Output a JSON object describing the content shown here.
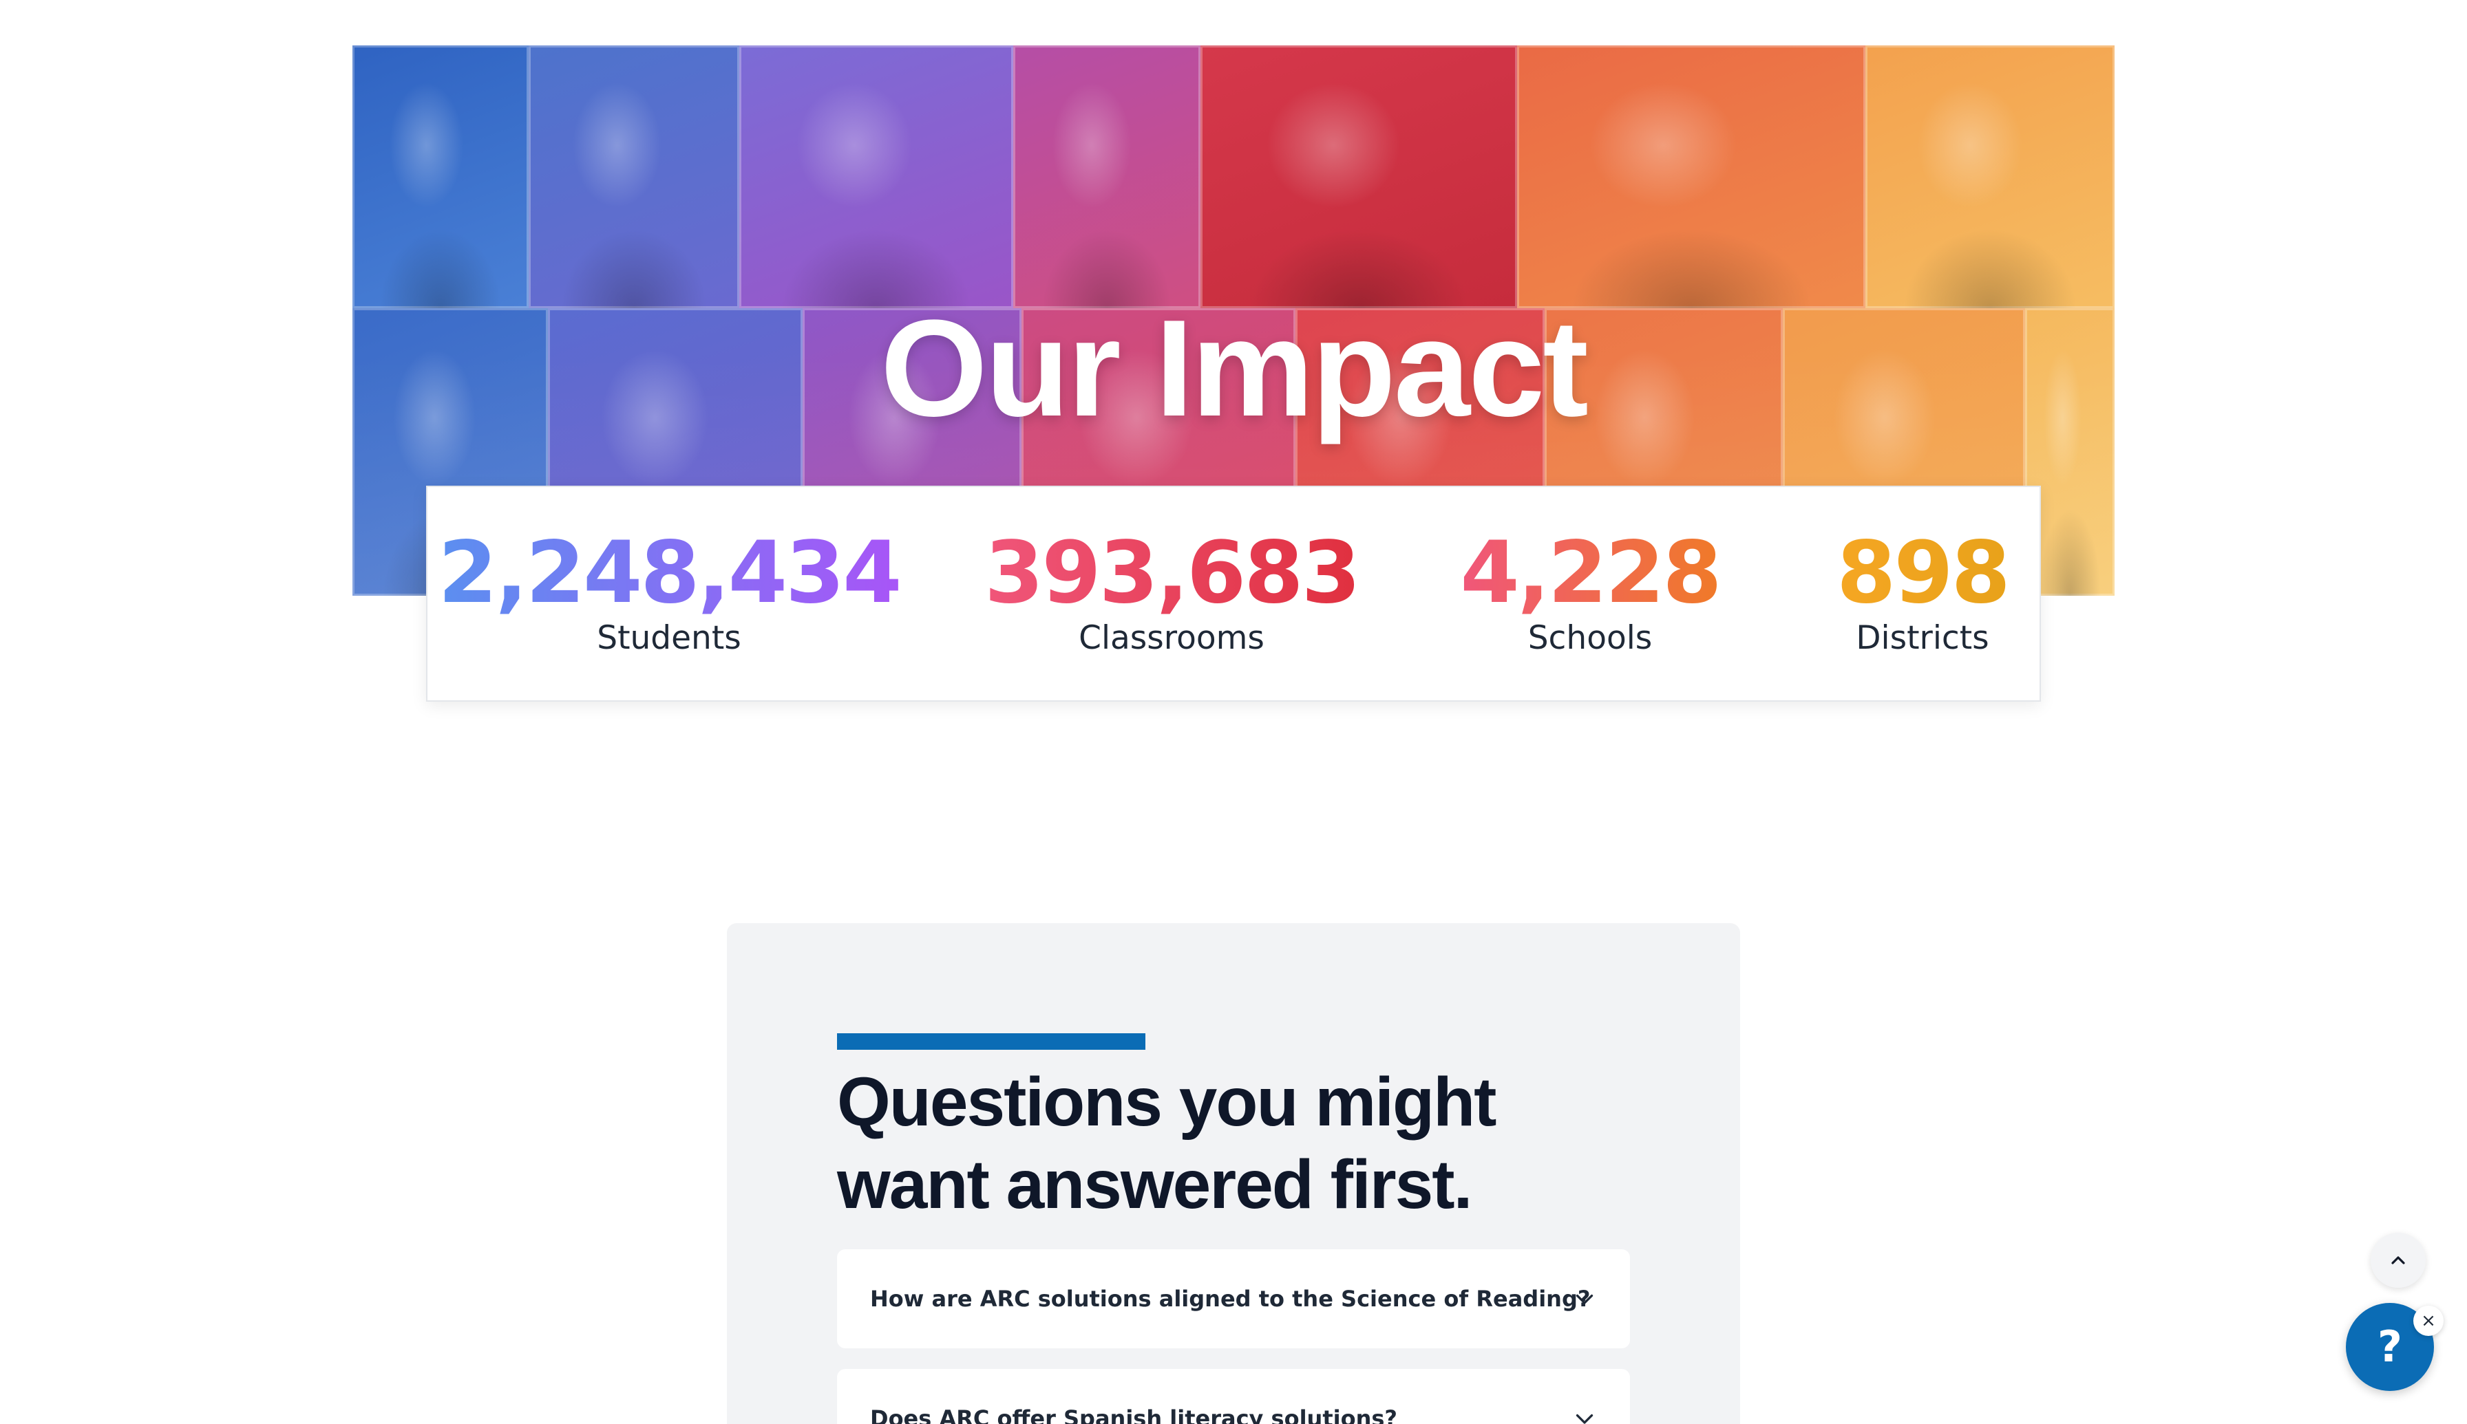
{
  "hero": {
    "title": "Our Impact"
  },
  "stats": [
    {
      "value": "2,248,434",
      "label": "Students",
      "gradient": [
        "#5b8ff0",
        "#a855f7"
      ]
    },
    {
      "value": "393,683",
      "label": "Classrooms",
      "gradient": [
        "#f0567a",
        "#e0303f"
      ]
    },
    {
      "value": "4,228",
      "label": "Schools",
      "gradient": [
        "#f0567a",
        "#f07a28"
      ]
    },
    {
      "value": "898",
      "label": "Districts",
      "gradient": [
        "#f5a623",
        "#e8a21a"
      ]
    }
  ],
  "faq": {
    "heading": "Questions you might want answered first.",
    "items": [
      {
        "question": "How are ARC solutions aligned to the Science of Reading?"
      },
      {
        "question": "Does ARC offer Spanish literacy solutions?"
      }
    ]
  },
  "floating": {
    "scroll_top_icon": "chevron-up-icon",
    "help_label": "?",
    "close_label": "×"
  },
  "colors": {
    "accent": "#0b6cb5",
    "heading": "#0f1729",
    "faq_background": "#f2f3f5"
  }
}
